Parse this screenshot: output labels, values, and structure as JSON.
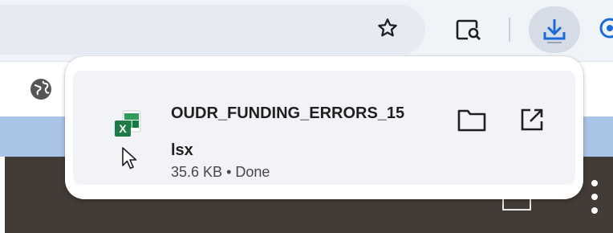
{
  "file": {
    "name_line1": "OUDR_FUNDING_ERRORS_15",
    "name_line2": "lsx",
    "size": "35.6 KB",
    "separator": "•",
    "status": "Done"
  },
  "toolbar": {
    "bookmark_icon": "star-outline",
    "tab_search_icon": "tab-search",
    "download_icon": "download-arrow",
    "profile_icon": "profile"
  },
  "actions": {
    "show_in_folder_icon": "folder-outline",
    "open_icon": "open-in-new"
  },
  "colors": {
    "accent_blue": "#1a6bd8",
    "excel_green": "#1e7b45",
    "bubble_row_bg": "#f1f3f6",
    "page_dark_band": "#433b35",
    "page_blue_band": "#a9c4e7"
  }
}
